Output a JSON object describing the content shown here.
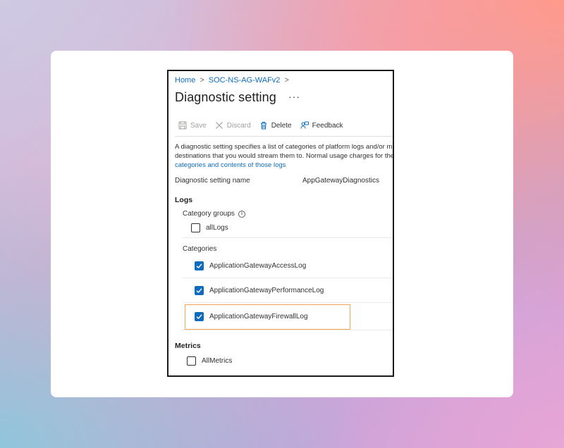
{
  "breadcrumb": {
    "home": "Home",
    "resource": "SOC-NS-AG-WAFv2",
    "separator": ">"
  },
  "page": {
    "title": "Diagnostic setting",
    "more": "···"
  },
  "toolbar": {
    "save_label": "Save",
    "discard_label": "Discard",
    "delete_label": "Delete",
    "feedback_label": "Feedback"
  },
  "description": {
    "line1": "A diagnostic setting specifies a list of categories of platform logs and/or m",
    "line2": "destinations that you would stream them to. Normal usage charges for the",
    "link": "categories and contents of those logs"
  },
  "setting": {
    "name_label": "Diagnostic setting name",
    "name_value": "AppGatewayDiagnostics"
  },
  "logs": {
    "heading": "Logs",
    "category_groups_label": "Category groups",
    "info_icon": "i",
    "all_logs": {
      "label": "allLogs",
      "checked": false
    },
    "categories_label": "Categories",
    "categories": [
      {
        "label": "ApplicationGatewayAccessLog",
        "checked": true
      },
      {
        "label": "ApplicationGatewayPerformanceLog",
        "checked": true
      },
      {
        "label": "ApplicationGatewayFirewallLog",
        "checked": true
      }
    ]
  },
  "metrics": {
    "heading": "Metrics",
    "all_metrics": {
      "label": "AllMetrics",
      "checked": false
    }
  },
  "colors": {
    "accent": "#0f6cbd",
    "highlight": "#f5a354"
  }
}
